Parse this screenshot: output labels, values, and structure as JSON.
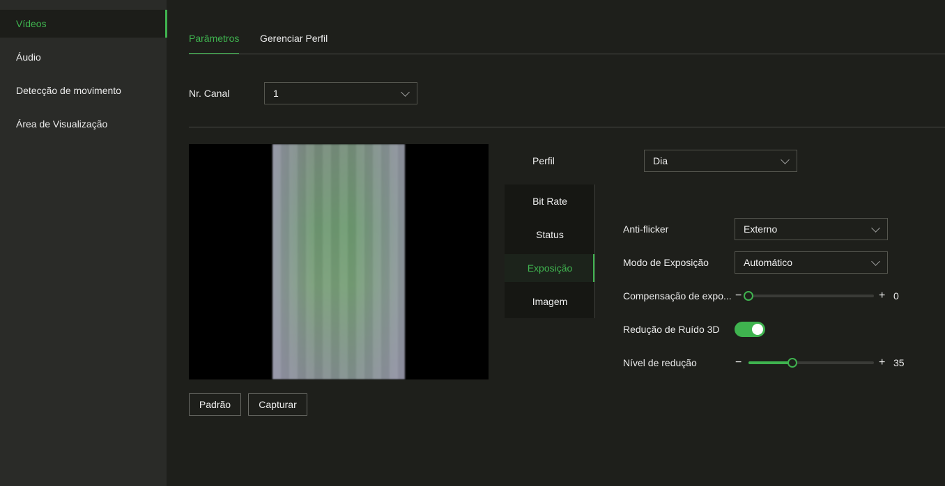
{
  "sidebar": {
    "items": [
      {
        "label": "Vídeos",
        "active": true
      },
      {
        "label": "Áudio"
      },
      {
        "label": "Detecção de movimento"
      },
      {
        "label": "Área de Visualização"
      }
    ]
  },
  "tabs": [
    {
      "label": "Parâmetros",
      "active": true
    },
    {
      "label": "Gerenciar Perfil"
    }
  ],
  "channel": {
    "label": "Nr. Canal",
    "value": "1"
  },
  "profile": {
    "label": "Perfil",
    "value": "Dia"
  },
  "buttons": {
    "default_label": "Padrão",
    "capture_label": "Capturar"
  },
  "side_tabs": [
    {
      "label": "Bit Rate"
    },
    {
      "label": "Status"
    },
    {
      "label": "Exposição",
      "active": true
    },
    {
      "label": "Imagem"
    }
  ],
  "settings": {
    "anti_flicker": {
      "label": "Anti-flicker",
      "value": "Externo"
    },
    "exposure_mode": {
      "label": "Modo de Exposição",
      "value": "Automático"
    },
    "exposure_comp": {
      "label": "Compensação de expo...",
      "value": "0",
      "minus": "−",
      "plus": "+",
      "fraction": 0.0
    },
    "noise_3d": {
      "label": "Redução de Ruído 3D",
      "enabled": true
    },
    "reduction_level": {
      "label": "Nível de redução",
      "value": "35",
      "minus": "−",
      "plus": "+",
      "fraction": 0.35
    }
  },
  "colors": {
    "accent": "#3fb34f",
    "background": "#1e1f1b",
    "sidebar": "#2a2b28"
  }
}
